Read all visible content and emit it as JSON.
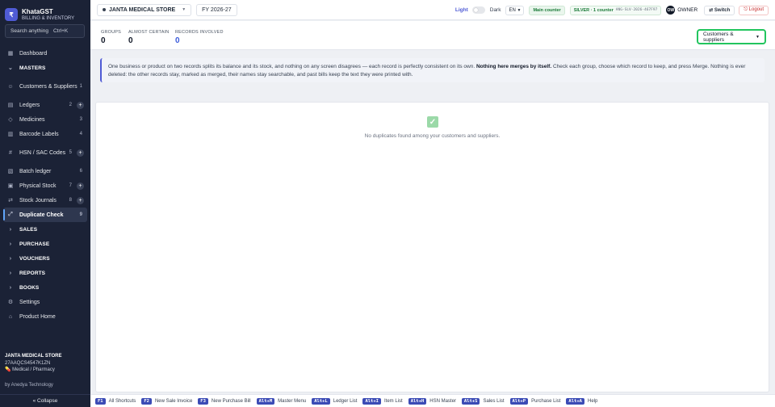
{
  "brand": {
    "logo": "₹",
    "name": "KhataGST",
    "subtitle": "BILLING & INVENTORY"
  },
  "search": {
    "placeholder": "Search anything",
    "shortcut": "Ctrl+K"
  },
  "nav": [
    {
      "icon": "▦",
      "label": "Dashboard",
      "count": "",
      "plus": false,
      "kind": "item"
    },
    {
      "icon": "⌄",
      "label": "MASTERS",
      "count": "",
      "plus": false,
      "kind": "section"
    },
    {
      "icon": "☺",
      "label": "Customers & Suppliers",
      "count": "1",
      "plus": false,
      "kind": "tall"
    },
    {
      "icon": "▤",
      "label": "Ledgers",
      "count": "2",
      "plus": true,
      "kind": "item"
    },
    {
      "icon": "◇",
      "label": "Medicines",
      "count": "3",
      "plus": false,
      "kind": "item"
    },
    {
      "icon": "▥",
      "label": "Barcode Labels",
      "count": "4",
      "plus": false,
      "kind": "item"
    },
    {
      "icon": "#",
      "label": "HSN / SAC Codes",
      "count": "5",
      "plus": true,
      "kind": "tall"
    },
    {
      "icon": "▧",
      "label": "Batch ledger",
      "count": "6",
      "plus": false,
      "kind": "item"
    },
    {
      "icon": "▣",
      "label": "Physical Stock",
      "count": "7",
      "plus": true,
      "kind": "item"
    },
    {
      "icon": "⇄",
      "label": "Stock Journals",
      "count": "8",
      "plus": true,
      "kind": "item"
    },
    {
      "icon": "⤢",
      "label": "Duplicate Check",
      "count": "9",
      "plus": false,
      "kind": "active"
    },
    {
      "icon": "›",
      "label": "SALES",
      "count": "",
      "plus": false,
      "kind": "section"
    },
    {
      "icon": "›",
      "label": "PURCHASE",
      "count": "",
      "plus": false,
      "kind": "section"
    },
    {
      "icon": "›",
      "label": "VOUCHERS",
      "count": "",
      "plus": false,
      "kind": "section"
    },
    {
      "icon": "›",
      "label": "REPORTS",
      "count": "",
      "plus": false,
      "kind": "section"
    },
    {
      "icon": "›",
      "label": "BOOKS",
      "count": "",
      "plus": false,
      "kind": "section"
    },
    {
      "icon": "⚙",
      "label": "Settings",
      "count": "",
      "plus": false,
      "kind": "item"
    },
    {
      "icon": "⌂",
      "label": "Product Home",
      "count": "",
      "plus": false,
      "kind": "item"
    }
  ],
  "footer": {
    "store": "JANTA MEDICAL STORE",
    "gstin": "27AAQCS4547K1ZN",
    "category": "Medical / Pharmacy",
    "by": "by Anedya Technology",
    "collapse": "« Collapse"
  },
  "topbar": {
    "store": "JANTA MEDICAL STORE",
    "fy": "FY 2026-27",
    "light": "Light",
    "dark": "Dark",
    "lang": "EN",
    "main_counter": "Main counter",
    "silver": "SILVER · 1 counter",
    "license_code": "ANG-SLV-2026-467F97",
    "avatar": "OW",
    "owner": "OWNER",
    "switch": "⇄ Switch",
    "logout": "⎋ Logout"
  },
  "stats": [
    {
      "label": "GROUPS",
      "value": "0"
    },
    {
      "label": "ALMOST CERTAIN",
      "value": "0"
    },
    {
      "label": "RECORDS INVOLVED",
      "value": "0"
    }
  ],
  "type_select": {
    "value": "Customers & suppliers"
  },
  "banner": {
    "pre": "One business or product on two records splits its balance and its stock, and nothing on any screen disagrees — each record is perfectly consistent on its own. ",
    "bold": "Nothing here merges by itself.",
    "post": " Check each group, choose which record to keep, and press Merge. Nothing is ever deleted: the other records stay, marked as merged, their names stay searchable, and past bills keep the text they were printed with."
  },
  "empty": {
    "message": "No duplicates found among your customers and suppliers."
  },
  "shortcuts": [
    {
      "key": "F1",
      "label": "All Shortcuts"
    },
    {
      "key": "F2",
      "label": "New Sale Invoice"
    },
    {
      "key": "F3",
      "label": "New Purchase Bill"
    },
    {
      "key": "Alt+M",
      "label": "Master Menu"
    },
    {
      "key": "Alt+L",
      "label": "Ledger List"
    },
    {
      "key": "Alt+I",
      "label": "Item List"
    },
    {
      "key": "Alt+H",
      "label": "HSN Master"
    },
    {
      "key": "Alt+S",
      "label": "Sales List"
    },
    {
      "key": "Alt+P",
      "label": "Purchase List"
    },
    {
      "key": "Alt+A",
      "label": "Help"
    }
  ]
}
